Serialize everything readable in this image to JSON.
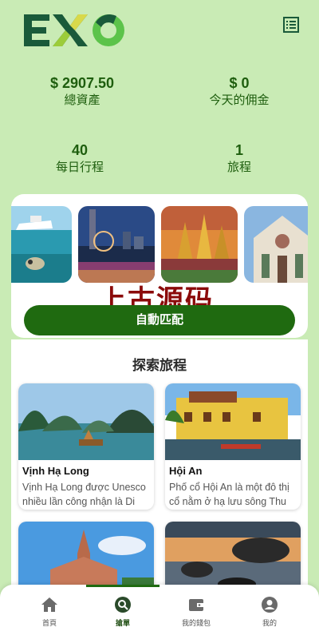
{
  "app": {
    "logo_text": "EXO"
  },
  "stats": [
    {
      "value": "$ 2907.50",
      "label": "總資產"
    },
    {
      "value": "$ 0",
      "label": "今天的佣金"
    },
    {
      "value": "40",
      "label": "每日行程"
    },
    {
      "value": "1",
      "label": "旅程"
    }
  ],
  "watermark": "上古源码",
  "auto_match_label": "自動匹配",
  "explore": {
    "title": "探索旅程",
    "cards": [
      {
        "name": "Vịnh Hạ Long",
        "desc": "Vịnh Hạ Long được Unesco nhiều lần công nhận là Di sản Thiên nhiên Thế giới"
      },
      {
        "name": "Hội An",
        "desc": "Phố cổ Hội An là một đô thị cổ nằm ở hạ lưu sông Thu Bồn"
      },
      {
        "name": "",
        "desc": ""
      },
      {
        "name": "",
        "desc": ""
      }
    ]
  },
  "nav": [
    {
      "label": "首頁",
      "icon": "home-icon"
    },
    {
      "label": "搶單",
      "icon": "search-location-icon"
    },
    {
      "label": "我的錢包",
      "icon": "wallet-icon"
    },
    {
      "label": "我的",
      "icon": "account-icon"
    }
  ],
  "colors": {
    "background": "#c9ebb5",
    "accent": "#1f6a10",
    "stat_text": "#1e5e0e",
    "watermark": "#8b0a0a"
  }
}
